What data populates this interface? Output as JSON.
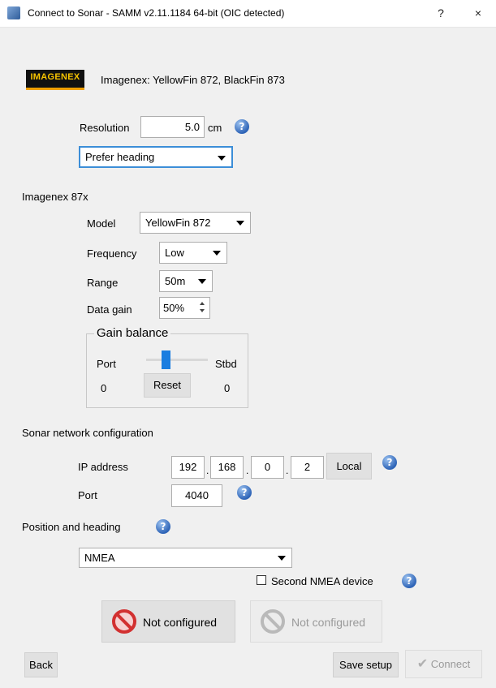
{
  "window": {
    "title": "Connect to Sonar - SAMM v2.11.1184 64-bit (OIC detected)",
    "help_label": "?",
    "close_label": "×"
  },
  "vendor": {
    "logo_text": "IMAGENEX",
    "device_name": "Imagenex: YellowFin 872, BlackFin 873"
  },
  "resolution": {
    "label": "Resolution",
    "value": "5.0",
    "unit": "cm",
    "help": "?"
  },
  "heading_mode": {
    "selected": "Prefer heading"
  },
  "imagenex": {
    "section_label": "Imagenex 87x",
    "model_label": "Model",
    "model_value": "YellowFin 872",
    "frequency_label": "Frequency",
    "frequency_value": "Low",
    "range_label": "Range",
    "range_value": "50m",
    "gain_label": "Data gain",
    "gain_value": "50%",
    "gain_balance": {
      "title": "Gain balance",
      "port_label": "Port",
      "stbd_label": "Stbd",
      "port_value": "0",
      "stbd_value": "0",
      "reset_label": "Reset",
      "slider_level": 0.5
    }
  },
  "network": {
    "section_label": "Sonar network configuration",
    "ip_label": "IP address",
    "ip_octets": [
      "192",
      "168",
      "0",
      "2"
    ],
    "ip_separator": ".",
    "local_label": "Local",
    "port_label": "Port",
    "port_value": "4040",
    "help": "?"
  },
  "position": {
    "section_label": "Position and heading",
    "source_value": "NMEA",
    "second_device_label": "Second NMEA device",
    "second_device_checked": false,
    "help": "?"
  },
  "status_buttons": {
    "primary_label": "Not configured",
    "secondary_label": "Not configured"
  },
  "footer": {
    "back_label": "Back",
    "save_label": "Save setup",
    "connect_label": "Connect"
  },
  "colors": {
    "accent_blue": "#3c8ed8",
    "slider_blue": "#1a7de0",
    "error_red": "#d23030"
  }
}
